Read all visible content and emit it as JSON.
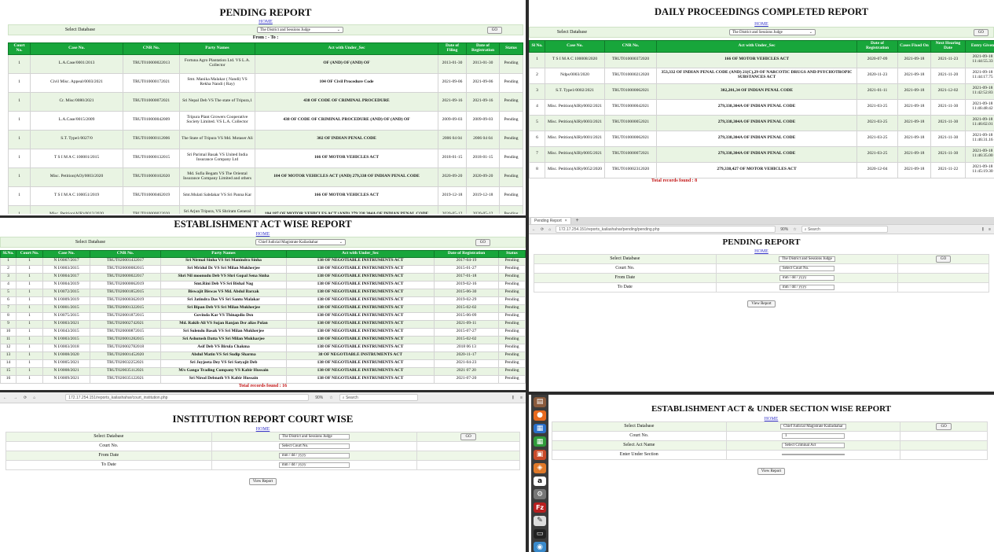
{
  "p1": {
    "title": "PENDING REPORT",
    "home": "HOME",
    "select_label": "Select Database",
    "select_value": "The District and Sessions Judge",
    "go": "GO",
    "from_to": "From : - To : ",
    "headers": [
      "Court No.",
      "Case No.",
      "CNR No.",
      "Party Names",
      "Act with Under_Sec",
      "Date of Filing",
      "Date of Registration",
      "Status"
    ],
    "rows": [
      [
        "1",
        "L.A.Case/0001/2013",
        "TRUT010000022013",
        "Fortuna Agro Plantation Ltd. VS L.A. Collector",
        "OF (AND) OF (AND) OF",
        "2013-01-30",
        "2013-01-30",
        "Pending"
      ],
      [
        "1",
        "Civil Misc. Appeal/0003/2021",
        "TRUT010000172021",
        "Smt. Manika Malakar ( Nandi) VS Rekha Nandi ( Ray)",
        "104 OF Civil Procedure Code",
        "2021-09-06",
        "2021-09-06",
        "Pending"
      ],
      [
        "1",
        "Cr. Misc/0080/2021",
        "TRUT010000072021",
        "Sri Nepal Deb VS The state of Tripura,1",
        "438 OF CODE OF CRIMINAL PROCEDURE",
        "2021-09-16",
        "2021-09-16",
        "Pending"
      ],
      [
        "1",
        "L.A.Case/0015/2009",
        "TRUT010000042009",
        "Tripura Plant Growers Cooperative Society Limited. VS L.A. Collector",
        "438 OF CODE OF CRIMINAL PROCEDURE (AND) OF (AND) OF",
        "2009-09-03",
        "2009-09-03",
        "Pending"
      ],
      [
        "1",
        "S.T. Type1/0027/0",
        "TRUT010000112006",
        "The State of Tripura VS Md. Motaser Ali",
        "302 OF INDIAN PENAL CODE",
        "2006 04 04",
        "2006 04 04",
        "Pending"
      ],
      [
        "1",
        "T S I M A C 100001/2015",
        "TRUT010000132015",
        "Sri Parimal Basak VS United India Insurance Company Ltd",
        "166 OF MOTOR VEHICLES ACT",
        "2018-01-15",
        "2018-01-15",
        "Pending"
      ],
      [
        "1",
        "Misc. Petition(AO)/0003/2020",
        "TRUT010000102020",
        "Md. Sufia Begam VS The Oriental Insurance Company Limited and others",
        "104 OF MOTOR VEHICLES ACT (AND) 279,338 OF INDIAN PENAL CODE",
        "2020-09-20",
        "2020-09-20",
        "Pending"
      ],
      [
        "1",
        "T S I M A C 100051/2019",
        "TRUT010000462019",
        "Smt.Mulati Sabdakar VS Sri Panna Kar",
        "166 OF MOTOR VEHICLES ACT",
        "2019-12-18",
        "2019-12-18",
        "Pending"
      ],
      [
        "1",
        "Misc. Petition(AIR)/0013/2020",
        "TRUT010000022020",
        "Sri Arjun Tripura, VS Shriram General Insurance Co. Ltd",
        "184,187 OF MOTOR VEHICLES ACT (AND) 279,338,304A OF INDIAN PENAL CODE",
        "2020-05-12",
        "2020-05-12",
        "Pending"
      ]
    ]
  },
  "p2": {
    "title": "DAILY PROCEEDINGS COMPLETED REPORT",
    "home": "HOME",
    "select_label": "Select Database",
    "select_value": "The District and Sessions Judge",
    "go": "GO",
    "headers": [
      "Sl No.",
      "Case No.",
      "CNR No.",
      "Act with Under_Sec",
      "Date of Registration",
      "Cases Fixed On",
      "Next Hearing Date",
      "Entry Given"
    ],
    "rows": [
      [
        "1",
        "T S I M A C 100008/2020",
        "TRUT010000372020",
        "166 OF MOTOR VEHICLES ACT",
        "2020-07-09",
        "2021-09-18",
        "2021-11-23",
        "2021-09-18 11:44:55.33"
      ],
      [
        "2",
        "Ndps/0003/2020",
        "TRUT010000212020",
        "353,332 OF INDIAN PENAL CODE (AND) 21(C),29 OF NARCOTIC DRUGS AND PSYCHOTROPIC SUBSTANCES ACT",
        "2020-11-23",
        "2021-09-18",
        "2021-11-20",
        "2021-09-18 11:44:17.75"
      ],
      [
        "3",
        "S.T. Type1/0002/2021",
        "TRUT010000062021",
        "302,201,34 OF INDIAN PENAL CODE",
        "2021-01-11",
        "2021-09-18",
        "2021-12-02",
        "2021-09-18 11:42:52.83"
      ],
      [
        "4",
        "Misc. Petition(AIR)/0002/2021",
        "TRUT010000042021",
        "279,338,304A OF INDIAN PENAL CODE",
        "2021-03-25",
        "2021-09-18",
        "2021-11-30",
        "2021-09-18 11:46:48:42"
      ],
      [
        "5",
        "Misc. Petition(AIR)/0003/2021",
        "TRUT010000052021",
        "279,338,304A OF INDIAN PENAL CODE",
        "2021-03-25",
        "2021-09-18",
        "2021-11-30",
        "2021-09-18 11:46:02.01"
      ],
      [
        "6",
        "Misc. Petition(AIR)/0001/2021",
        "TRUT010000062021",
        "279,338,304A OF INDIAN PENAL CODE",
        "2021-03-25",
        "2021-09-18",
        "2021-11-30",
        "2021-09-18 11:46:31.16"
      ],
      [
        "7",
        "Misc. Petition(AIR)/0005/2021",
        "TRUT010000072021",
        "279,338,304A OF INDIAN PENAL CODE",
        "2021-03-25",
        "2021-09-18",
        "2021-11-30",
        "2021-09-18 11:46:35.00"
      ],
      [
        "8",
        "Misc. Petition(AIR)/0052/2020",
        "TRUT010002312020",
        "279,338,427 OF MOTOR VEHICLES ACT",
        "2020-12-04",
        "2021-09-18",
        "2021-11-22",
        "2021-09-18 11:45:19.30"
      ]
    ],
    "total": "Total records found : 8"
  },
  "p3": {
    "title": "ESTABLISHMENT ACT WISE REPORT",
    "home": "HOME",
    "select_label": "Select Database",
    "select_value": "Chief Judicial Magistrate Kailashahar",
    "go": "GO",
    "headers": [
      "Sl.No.",
      "Court No.",
      "Case No.",
      "CNR No.",
      "Party Names",
      "Act with Under_Sec",
      "Date of Registration",
      "Status"
    ],
    "rows": [
      [
        "1",
        "1",
        "N I/0067/2017",
        "TRUT020001432017",
        "Sri Nirmal Sinha VS Sri Manindra Sinha",
        "138 OF NEGOTIABLE INSTRUMENTS ACT",
        "2017-04-19",
        "Pending"
      ],
      [
        "2",
        "1",
        "N I/0003/2015",
        "TRUT020000082015",
        "Sri Mridul Dc VS Sri Milan Mukherjee",
        "138 OF NEGOTIABLE INSTRUMENTS ACT",
        "2015-01-27",
        "Pending"
      ],
      [
        "3",
        "1",
        "N I/0004/2017",
        "TRUT020000022017",
        "Shri Nil moonudu Deb VS Shri Gopal Sena Sinha",
        "138 OF NEGOTIABLE INSTRUMENTS ACT",
        "2017-01-18",
        "Pending"
      ],
      [
        "4",
        "1",
        "N I/0004/2019",
        "TRUT020000062019",
        "Smt.Rini Deb VS Sri Bishal Nag",
        "138 OF NEGOTIABLE INSTRUMENTS ACT",
        "2019-02-16",
        "Pending"
      ],
      [
        "5",
        "1",
        "N I/0072/2015",
        "TRUT020001852015",
        "Biswajit Biswas VS Md. Abdul Barzak",
        "138 OF NEGOTIABLE INSTRUMENTS ACT",
        "2015-06-30",
        "Pending"
      ],
      [
        "6",
        "1",
        "N I/0009/2019",
        "TRUT020000362019",
        "Sri Jatindra Das VS Sri Santu Malakar",
        "138 OF NEGOTIABLE INSTRUMENTS ACT",
        "2019-02-29",
        "Pending"
      ],
      [
        "7",
        "1",
        "N I/0001/2015",
        "TRUT020001322015",
        "Sri Bipan Deb VS Sri Milan Mukherjee",
        "138 OF NEGOTIABLE INSTRUMENTS ACT",
        "2015-02-02",
        "Pending"
      ],
      [
        "8",
        "1",
        "N I/0075/2015",
        "TRUT020001872015",
        "Govinda Kar VS Thinapdio Dsn",
        "138 OF NEGOTIABLE INSTRUMENTS ACT",
        "2015-06-09",
        "Pending"
      ],
      [
        "9",
        "1",
        "N I/0003/2021",
        "TRUT020002742021",
        "Md. Rakib Ali VS Sujan Ranjan Dsr alias Polan",
        "138 OF NEGOTIABLE INSTRUMENTS ACT",
        "2021-09-11",
        "Pending"
      ],
      [
        "10",
        "1",
        "N I/0043/2015",
        "TRUT020000872015",
        "Sri Sulendu Basak VS Sri Milan Mukherjee",
        "138 OF NEGOTIABLE INSTRUMENTS ACT",
        "2015-07-27",
        "Pending"
      ],
      [
        "11",
        "1",
        "N I/0003/2015",
        "TRUT020001282015",
        "Sri Ashutosh Datta VS Sri Milan Mukharjee",
        "138 OF NEGOTIABLE INSTRUMENTS ACT",
        "2015-02-02",
        "Pending"
      ],
      [
        "12",
        "1",
        "N I/0003/2018",
        "TRUT020002782018",
        "Asif Deb VS Birula Chakma",
        "138 OF NEGOTIABLE INSTRUMENTS ACT",
        "2018 06 13",
        "Pending"
      ],
      [
        "13",
        "1",
        "N I/0008/2020",
        "TRUT020001452020",
        "Abdul Matin VS Sri Sudip Sharma",
        "38 OF NEGOTIABLE INSTRUMENTS ACT",
        "2020-11-17",
        "Pending"
      ],
      [
        "14",
        "1",
        "N I/0005/2021",
        "TRUT020032252021",
        "Sri Joyjeeta Dey VS Sri Satyajit Deb",
        "138 OF NEGOTIABLE INSTRUMENTS ACT",
        "2021-04-23",
        "Pending"
      ],
      [
        "15",
        "1",
        "N I/0008/2021",
        "TRUT020035112021",
        "M/s Ganga Trading Company VS Kabir Hussain",
        "138 OF NEGOTIABLE INSTRUMENTS ACT",
        "2021 07 20",
        "Pending"
      ],
      [
        "16",
        "1",
        "N I/0009/2021",
        "TRUT020035122021",
        "Sri Nirod Debnath VS Kabir Hussain",
        "138 OF NEGOTIABLE INSTRUMENTS ACT",
        "2021-07-20",
        "Pending"
      ]
    ],
    "total": "Total records found : 16"
  },
  "p4": {
    "tab_title": "Pending Report",
    "tab_close": "×",
    "new_tab": "+",
    "url": "172.17.254.151/reports_kailashahar/pending/pending.php",
    "zoom": "90%",
    "search_placeholder": "Search",
    "title": "PENDING REPORT",
    "home": "HOME",
    "fields": [
      {
        "label": "Select Database",
        "value": "The District and Sessions Judge"
      },
      {
        "label": "Court No.",
        "value": "Select Court No."
      },
      {
        "label": "From Date",
        "value": "mm / dd / yyyy"
      },
      {
        "label": "To Date",
        "value": "mm / dd / yyyy"
      }
    ],
    "go": "GO",
    "view": "View Report"
  },
  "p5": {
    "url": "172.17.254.151/reports_kailashahar/court_institution.php",
    "zoom": "90%",
    "search_placeholder": "Search",
    "title": "INSTITUTION REPORT COURT WISE",
    "home": "HOME",
    "fields": [
      {
        "label": "Select Database",
        "value": "The District and Sessions Judge"
      },
      {
        "label": "Court No.",
        "value": "Select Court No."
      },
      {
        "label": "From Date",
        "value": "mm / dd / yyyy"
      },
      {
        "label": "To Date",
        "value": "mm / dd / yyyy"
      }
    ],
    "go": "GO",
    "view": "View Report"
  },
  "p6": {
    "title": "ESTABLISHMENT ACT & UNDER SECTION WISE REPORT",
    "home": "HOME",
    "fields": [
      {
        "label": "Select Database",
        "value": "Chief Judicial Magistrate Kailashahar"
      },
      {
        "label": "Court No.",
        "value": "1"
      },
      {
        "label": "Select Act Name",
        "value": "Select Criminal Act"
      },
      {
        "label": "Enter Under Section",
        "value": ""
      }
    ],
    "go": "GO",
    "view": "View Report"
  },
  "launcher": [
    "a",
    "Fz"
  ]
}
